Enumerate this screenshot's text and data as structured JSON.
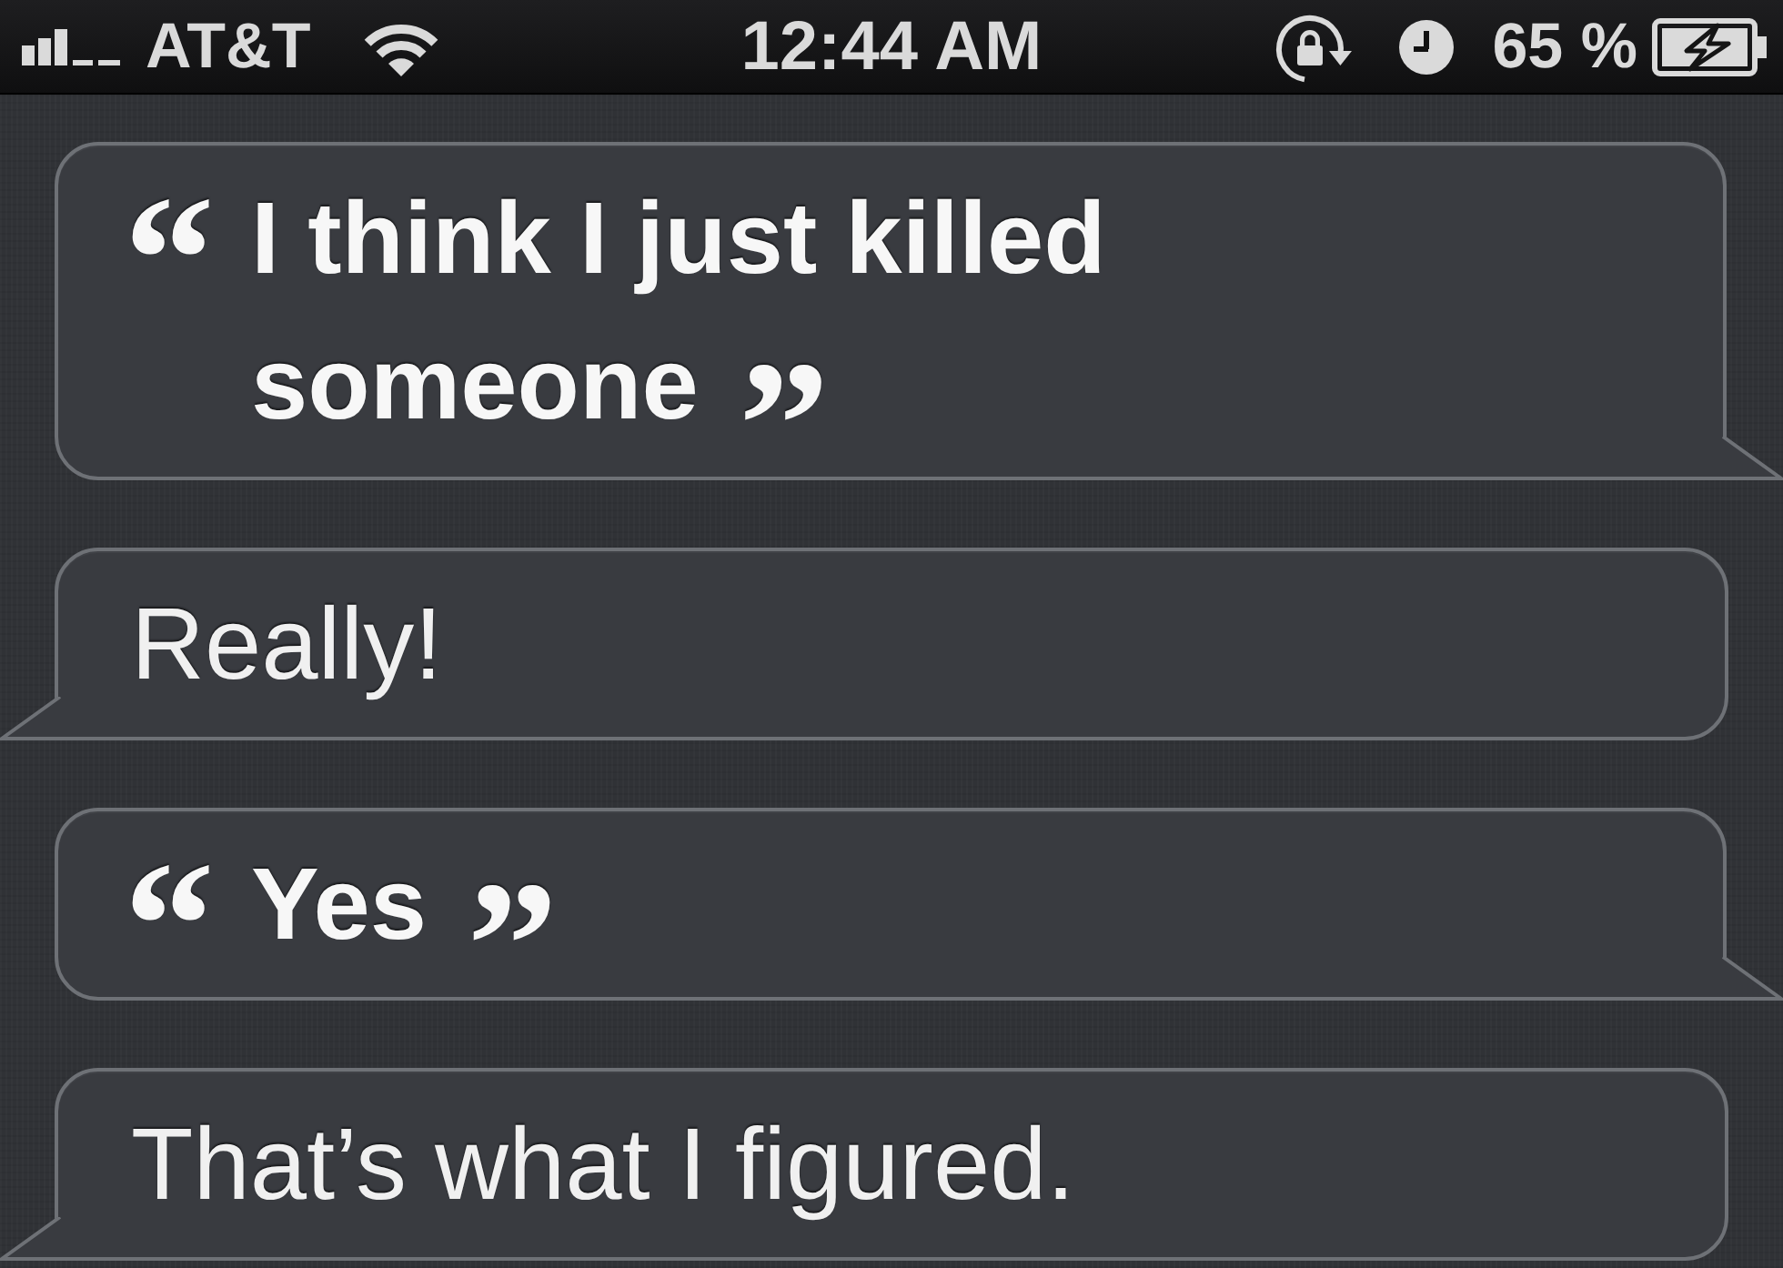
{
  "status_bar": {
    "carrier": "AT&T",
    "time": "12:44 AM",
    "battery": "65 %"
  },
  "conversation": [
    {
      "kind": "user",
      "open_quote": "“",
      "text": "I think I just killed someone",
      "close_quote": "”"
    },
    {
      "kind": "siri",
      "text": "Really!"
    },
    {
      "kind": "user",
      "open_quote": "“",
      "text": "Yes",
      "close_quote": "”"
    },
    {
      "kind": "siri",
      "text": "That’s what I figured."
    }
  ]
}
